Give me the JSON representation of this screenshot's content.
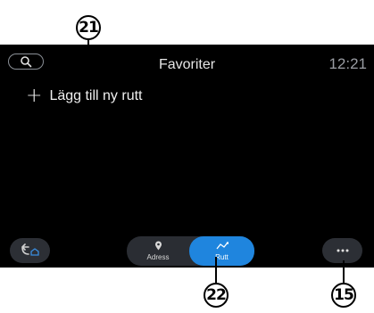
{
  "callouts": {
    "c21": "21",
    "c22": "22",
    "c15": "15"
  },
  "header": {
    "title": "Favoriter",
    "time": "12:21"
  },
  "main": {
    "add_route_label": "Lägg till ny rutt",
    "add_symbol": "+"
  },
  "tabs": [
    {
      "label": "Adress",
      "icon": "location-pin-icon",
      "selected": false
    },
    {
      "label": "Rutt",
      "icon": "route-icon",
      "selected": true
    }
  ],
  "more_button": {
    "label": "..."
  },
  "colors": {
    "accent": "#1f85de",
    "screen": "#000000",
    "button": "#2c2f35"
  }
}
